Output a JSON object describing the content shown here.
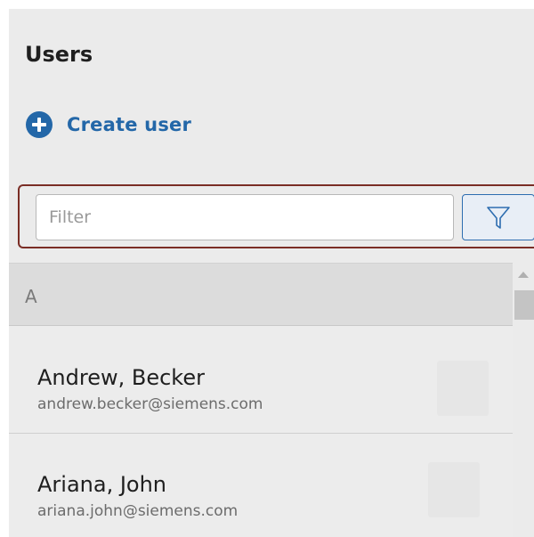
{
  "header": {
    "title": "Users"
  },
  "actions": {
    "create_label": "Create user",
    "create_icon": "plus-circle-icon"
  },
  "filter": {
    "placeholder": "Filter",
    "value": "",
    "button_icon": "funnel-icon"
  },
  "list": {
    "groups": [
      {
        "letter": "A",
        "users": [
          {
            "name": "Andrew, Becker",
            "email": "andrew.becker@siemens.com"
          },
          {
            "name": "Ariana, John",
            "email": "ariana.john@siemens.com"
          }
        ]
      }
    ]
  },
  "colors": {
    "accent": "#2367a8",
    "focus_outline": "#7a2d25",
    "background": "#ebebeb"
  }
}
